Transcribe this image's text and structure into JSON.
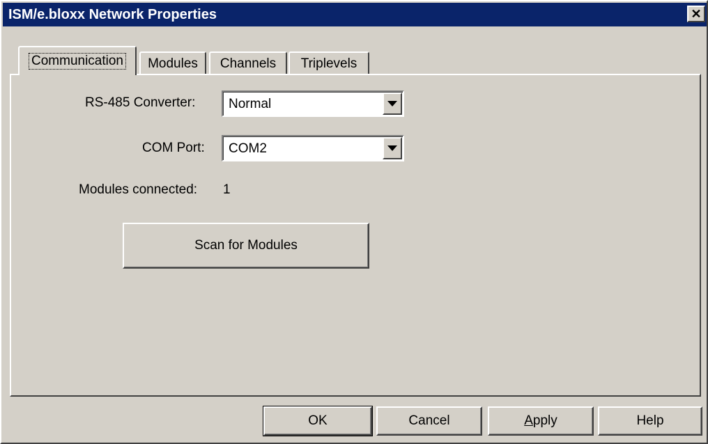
{
  "window": {
    "title": "ISM/e.bloxx Network Properties",
    "close_glyph": "✕"
  },
  "tabs": [
    {
      "label": "Communication",
      "active": true
    },
    {
      "label": "Modules",
      "active": false
    },
    {
      "label": "Channels",
      "active": false
    },
    {
      "label": "Triplevels",
      "active": false
    }
  ],
  "communication": {
    "rs485_label": "RS-485 Converter:",
    "rs485_value": "Normal",
    "com_port_label": "COM Port:",
    "com_port_value": "COM2",
    "modules_connected_label": "Modules connected:",
    "modules_connected_value": "1",
    "scan_button_label": "Scan for Modules"
  },
  "footer": {
    "ok_label": "OK",
    "cancel_label": "Cancel",
    "apply_label_accel": "A",
    "apply_label_rest": "pply",
    "help_label": "Help"
  },
  "colors": {
    "titlebar": "#0a246a",
    "face": "#d4d0c8",
    "title_text": "#ffffff"
  },
  "icons": {
    "close": "close-icon",
    "dropdown": "chevron-down-icon"
  }
}
